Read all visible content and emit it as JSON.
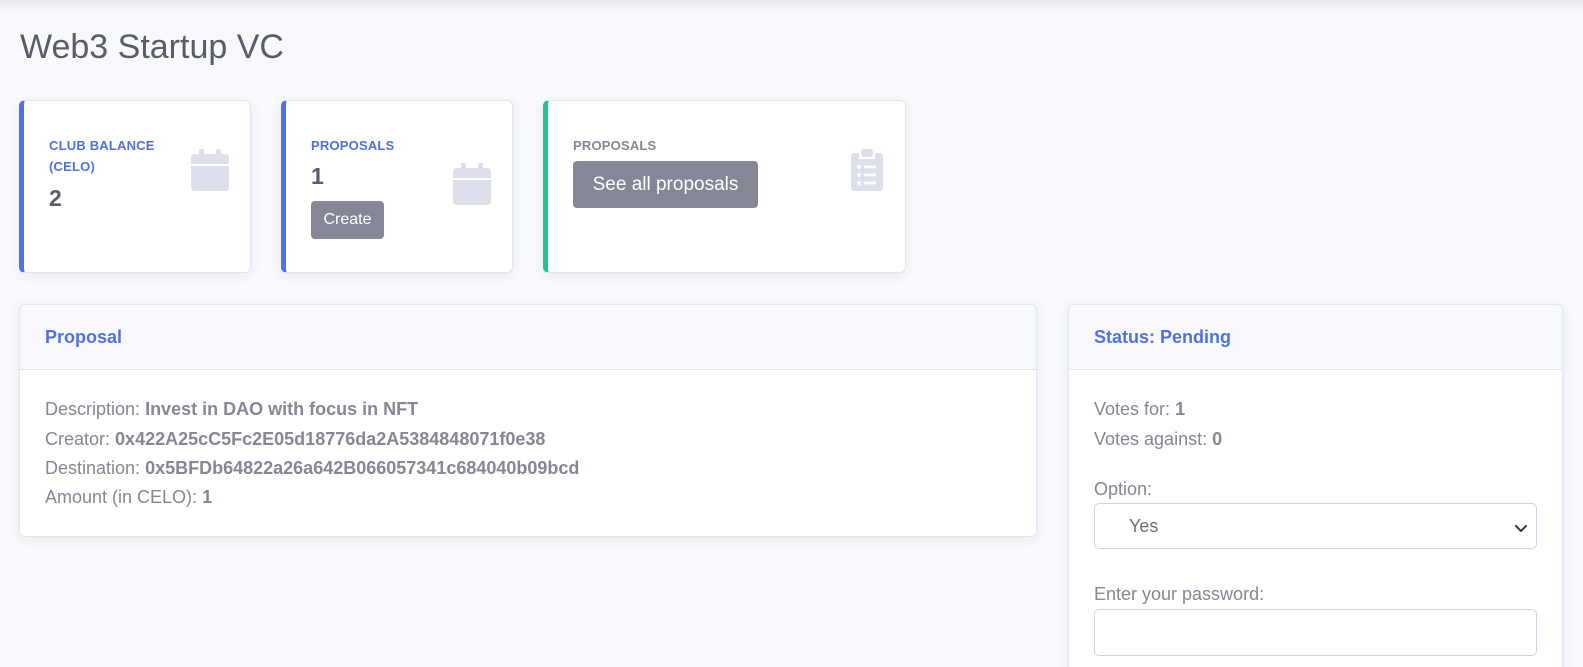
{
  "page": {
    "title": "Web3 Startup VC"
  },
  "stats": {
    "balance": {
      "label": "CLUB BALANCE (CELO)",
      "value": "2",
      "icon": "calendar-icon"
    },
    "proposals": {
      "label": "PROPOSALS",
      "value": "1",
      "button": "Create",
      "icon": "calendar-icon"
    },
    "all_proposals": {
      "label": "PROPOSALS",
      "button": "See all proposals",
      "icon": "clipboard-list-icon"
    }
  },
  "proposal": {
    "header": "Proposal",
    "description_label": "Description:",
    "description_value": "Invest in DAO with focus in NFT",
    "creator_label": "Creator:",
    "creator_value": "0x422A25cC5Fc2E05d18776da2A5384848071f0e38",
    "destination_label": "Destination:",
    "destination_value": "0x5BFDb64822a26a642B066057341c684040b09bcd",
    "amount_label": "Amount (in CELO):",
    "amount_value": "1"
  },
  "status": {
    "header": "Status: Pending",
    "votes_for_label": "Votes for:",
    "votes_for_value": "1",
    "votes_against_label": "Votes against:",
    "votes_against_value": "0",
    "option_label": "Option:",
    "option_selected": "Yes",
    "password_label": "Enter your password:",
    "password_value": ""
  },
  "colors": {
    "primary": "#4e73df",
    "success": "#1cc88a",
    "secondary": "#858796",
    "text_dark": "#5a5c69",
    "background": "#f8f9fc",
    "icon_gray": "#dddfeb"
  }
}
